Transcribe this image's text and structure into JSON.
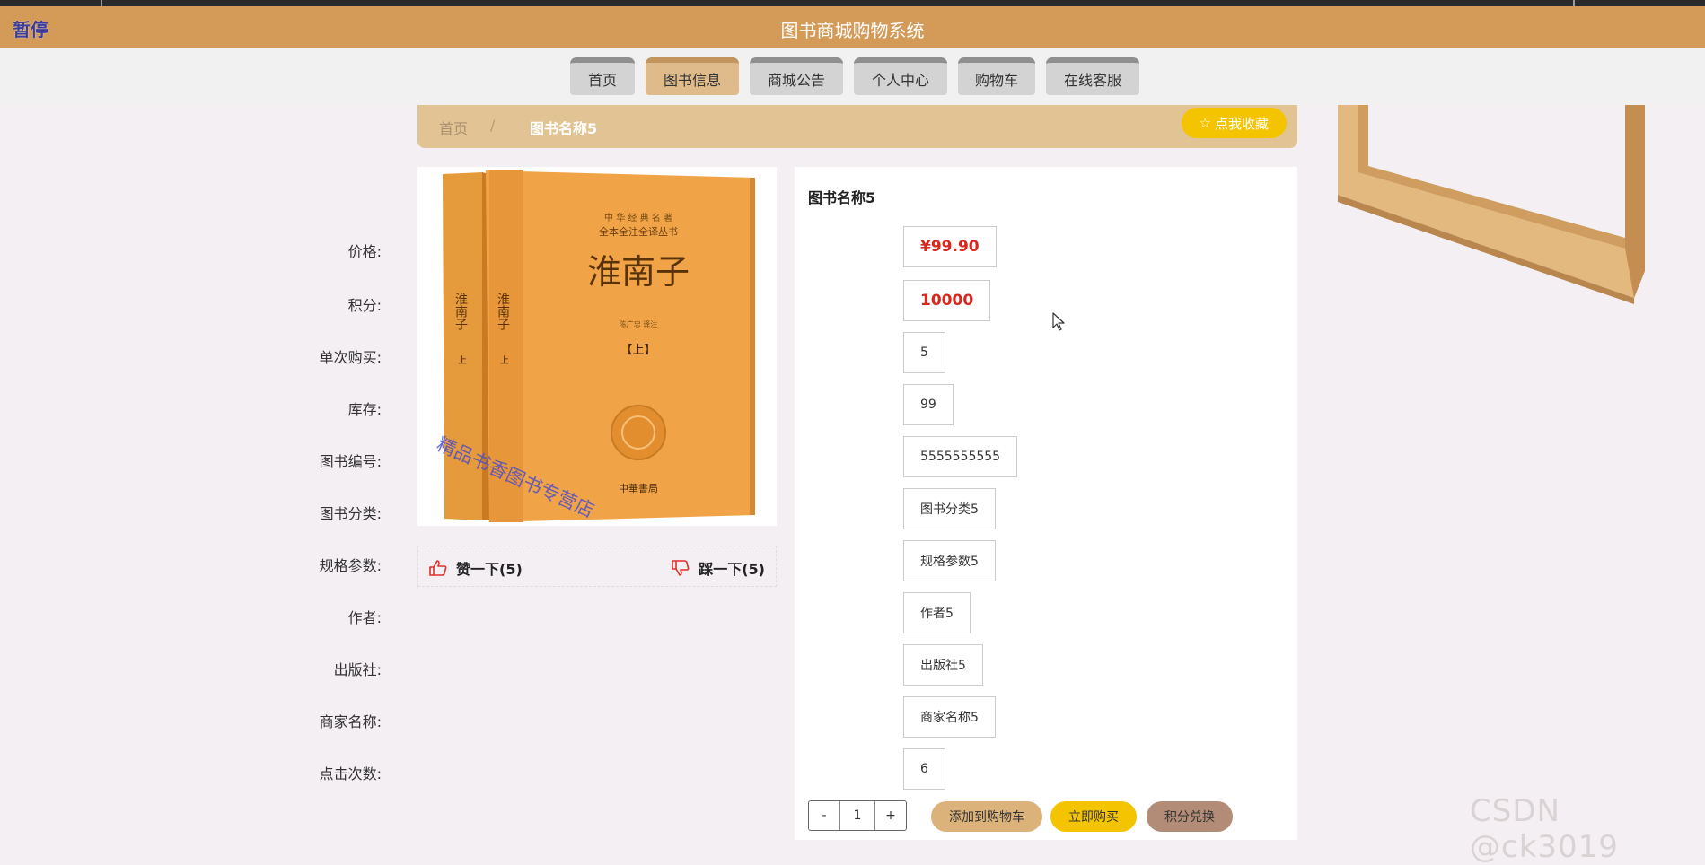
{
  "titlebar": {
    "pause_label": "暂停",
    "title": "图书商城购物系统"
  },
  "nav": {
    "tabs": [
      {
        "label": "首页"
      },
      {
        "label": "图书信息",
        "active": true
      },
      {
        "label": "商城公告"
      },
      {
        "label": "个人中心"
      },
      {
        "label": "购物车"
      },
      {
        "label": "在线客服"
      }
    ]
  },
  "breadcrumb": {
    "home": "首页",
    "separator": "/",
    "current": "图书名称5"
  },
  "favorite_button": {
    "label": "点我收藏",
    "icon": "star-icon"
  },
  "book_image": {
    "cover_series": "中 华 经 典 名 著",
    "cover_series2": "全本全注全译丛书",
    "cover_title": "淮南子",
    "cover_author": "陈广忠 译注",
    "cover_volume": "【上】",
    "publisher_mark": "中華書局",
    "spine_title": "淮南子",
    "spine_vol": "上",
    "overlay_text": "精品书香图书专营店"
  },
  "votes": {
    "like": "赞一下(5)",
    "dislike": "踩一下(5)"
  },
  "detail": {
    "title": "图书名称5",
    "rows": [
      {
        "label": "价格:",
        "value": "¥99.90"
      },
      {
        "label": "积分:",
        "value": "10000"
      },
      {
        "label": "单次购买:",
        "value": "5"
      },
      {
        "label": "库存:",
        "value": "99"
      },
      {
        "label": "图书编号:",
        "value": "5555555555"
      },
      {
        "label": "图书分类:",
        "value": "图书分类5"
      },
      {
        "label": "规格参数:",
        "value": "规格参数5"
      },
      {
        "label": "作者:",
        "value": "作者5"
      },
      {
        "label": "出版社:",
        "value": "出版社5"
      },
      {
        "label": "商家名称:",
        "value": "商家名称5"
      },
      {
        "label": "点击次数:",
        "value": "6"
      }
    ]
  },
  "quantity": {
    "minus": "-",
    "value": "1",
    "plus": "+"
  },
  "actions": {
    "add_to_cart": "添加到购物车",
    "buy_now": "立即购买",
    "points_exchange": "积分兑换"
  },
  "watermark": "CSDN @ck3019",
  "colors": {
    "accent": "#d49a58",
    "price_red": "#d8271c",
    "buy_yellow": "#f5c400",
    "points_brown": "#b28c76"
  }
}
